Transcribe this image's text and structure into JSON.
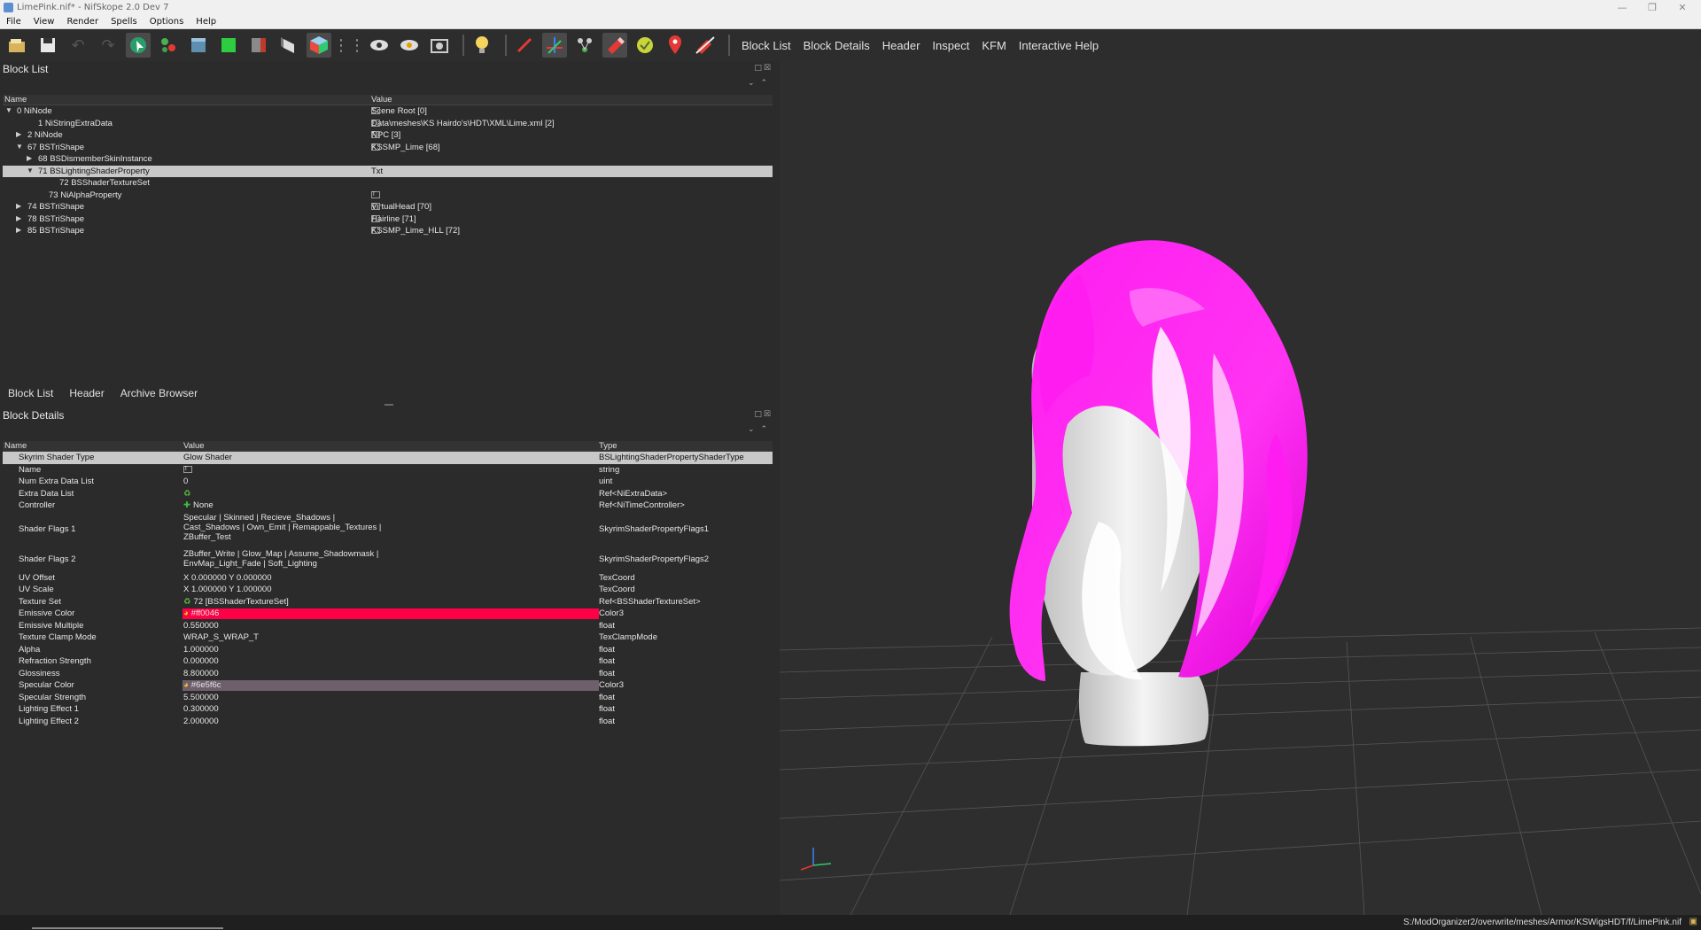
{
  "window": {
    "title": "LimePink.nif* - NifSkope 2.0 Dev 7"
  },
  "menu": [
    "File",
    "View",
    "Render",
    "Spells",
    "Options",
    "Help"
  ],
  "toolbar": {
    "text_buttons": [
      "Block List",
      "Block Details",
      "Header",
      "Inspect",
      "KFM",
      "Interactive Help"
    ]
  },
  "block_list": {
    "title": "Block List",
    "columns": {
      "name": "Name",
      "value": "Value"
    },
    "rows": [
      {
        "indent": 0,
        "expander": "open",
        "name": "0 NiNode",
        "value": "Scene Root [0]",
        "icon": true
      },
      {
        "indent": 2,
        "expander": "",
        "name": "1 NiStringExtraData",
        "value": "Data\\meshes\\KS Hairdo's\\HDT\\XML\\Lime.xml [2]",
        "icon": true
      },
      {
        "indent": 1,
        "expander": "closed",
        "name": "2 NiNode",
        "value": "NPC [3]",
        "icon": true
      },
      {
        "indent": 1,
        "expander": "open",
        "name": "67 BSTriShape",
        "value": "KSSMP_Lime [68]",
        "icon": true
      },
      {
        "indent": 2,
        "expander": "closed",
        "name": "68 BSDismemberSkinInstance",
        "value": "",
        "icon": false
      },
      {
        "indent": 2,
        "expander": "open",
        "name": "71 BSLightingShaderProperty",
        "value": "Txt",
        "icon": false,
        "selected": true
      },
      {
        "indent": 4,
        "expander": "",
        "name": "72 BSShaderTextureSet",
        "value": "",
        "icon": false
      },
      {
        "indent": 3,
        "expander": "",
        "name": "73 NiAlphaProperty",
        "value": "",
        "icon": true
      },
      {
        "indent": 1,
        "expander": "closed",
        "name": "74 BSTriShape",
        "value": "VirtualHead [70]",
        "icon": true
      },
      {
        "indent": 1,
        "expander": "closed",
        "name": "78 BSTriShape",
        "value": "Hairline [71]",
        "icon": true
      },
      {
        "indent": 1,
        "expander": "closed",
        "name": "85 BSTriShape",
        "value": "KSSMP_Lime_HLL [72]",
        "icon": true
      }
    ]
  },
  "tabs": [
    "Block List",
    "Header",
    "Archive Browser"
  ],
  "block_details": {
    "title": "Block Details",
    "columns": {
      "name": "Name",
      "value": "Value",
      "type": "Type"
    },
    "rows": [
      {
        "name": "Skyrim Shader Type",
        "value": "Glow Shader",
        "type": "BSLightingShaderPropertyShaderType",
        "h": 13.5,
        "selected": true
      },
      {
        "name": "Name",
        "value": "",
        "type": "string",
        "h": 13.5,
        "icon": "txt"
      },
      {
        "name": "Num Extra Data List",
        "value": "0",
        "type": "uint",
        "h": 13.5
      },
      {
        "name": "Extra Data List",
        "value": "",
        "type": "Ref<NiExtraData>",
        "h": 13.5,
        "icon": "link"
      },
      {
        "name": "Controller",
        "value": "None",
        "type": "Ref<NiTimeController>",
        "h": 13.5,
        "icon": "plus"
      },
      {
        "name": "Shader Flags 1",
        "value": "Specular | Skinned | Recieve_Shadows |\nCast_Shadows | Own_Emit | Remappable_Textures |\nZBuffer_Test",
        "type": "SkyrimShaderPropertyFlags1",
        "h": 41
      },
      {
        "name": "Shader Flags 2",
        "value": "ZBuffer_Write | Glow_Map | Assume_Shadowmask |\nEnvMap_Light_Fade | Soft_Lighting",
        "type": "SkyrimShaderPropertyFlags2",
        "h": 27
      },
      {
        "name": "UV Offset",
        "value": "X 0.000000 Y 0.000000",
        "type": "TexCoord",
        "h": 13.5
      },
      {
        "name": "UV Scale",
        "value": "X 1.000000 Y 1.000000",
        "type": "TexCoord",
        "h": 13.5
      },
      {
        "name": "Texture Set",
        "value": "72 [BSShaderTextureSet]",
        "type": "Ref<BSShaderTextureSet>",
        "h": 13.5,
        "icon": "link"
      },
      {
        "name": "Emissive Color",
        "value": "#ff0046",
        "type": "Color3",
        "h": 13.5,
        "icon": "wheel",
        "swatch": "#ff0046"
      },
      {
        "name": "Emissive Multiple",
        "value": "0.550000",
        "type": "float",
        "h": 13.5
      },
      {
        "name": "Texture Clamp Mode",
        "value": "WRAP_S_WRAP_T",
        "type": "TexClampMode",
        "h": 13.5
      },
      {
        "name": "Alpha",
        "value": "1.000000",
        "type": "float",
        "h": 13.5
      },
      {
        "name": "Refraction Strength",
        "value": "0.000000",
        "type": "float",
        "h": 13.5
      },
      {
        "name": "Glossiness",
        "value": "8.800000",
        "type": "float",
        "h": 13.5
      },
      {
        "name": "Specular Color",
        "value": "#6e5f6c",
        "type": "Color3",
        "h": 13.5,
        "icon": "wheel",
        "swatch": "#6e5f6c"
      },
      {
        "name": "Specular Strength",
        "value": "5.500000",
        "type": "float",
        "h": 13.5
      },
      {
        "name": "Lighting Effect 1",
        "value": "0.300000",
        "type": "float",
        "h": 13.5
      },
      {
        "name": "Lighting Effect 2",
        "value": "2.000000",
        "type": "float",
        "h": 13.5
      }
    ]
  },
  "status": {
    "path": "S:/ModOrganizer2/overwrite/meshes/Armor/KSWigsHDT/f/LimePink.nif"
  },
  "colors": {
    "hair": "#ff1cf0",
    "emissive": "#ff0046",
    "specular": "#6e5f6c",
    "selection": "#c8c8c8"
  }
}
